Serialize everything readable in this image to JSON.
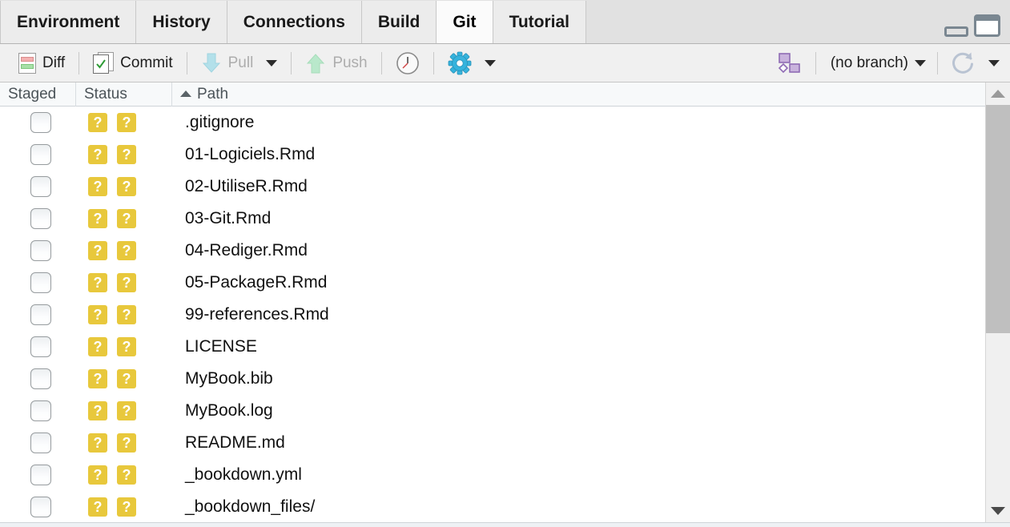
{
  "window": {
    "minimize_label": "Minimize",
    "maximize_label": "Maximize"
  },
  "tabs": [
    {
      "label": "Environment",
      "active": false
    },
    {
      "label": "History",
      "active": false
    },
    {
      "label": "Connections",
      "active": false
    },
    {
      "label": "Build",
      "active": false
    },
    {
      "label": "Git",
      "active": true
    },
    {
      "label": "Tutorial",
      "active": false
    }
  ],
  "toolbar": {
    "diff_label": "Diff",
    "commit_label": "Commit",
    "pull_label": "Pull",
    "push_label": "Push",
    "history_icon": "clock-icon",
    "gear_icon": "gear-icon",
    "new_branch_icon": "new-branch-icon",
    "refresh_icon": "refresh-icon",
    "branch_label": "(no branch)"
  },
  "table": {
    "columns": {
      "staged": "Staged",
      "status": "Status",
      "path": "Path"
    },
    "sort": {
      "column": "Path",
      "direction": "ascending"
    },
    "status_badge_color": "#e8c83c",
    "rows": [
      {
        "staged": false,
        "status_index": "?",
        "status_worktree": "?",
        "path": ".gitignore"
      },
      {
        "staged": false,
        "status_index": "?",
        "status_worktree": "?",
        "path": "01-Logiciels.Rmd"
      },
      {
        "staged": false,
        "status_index": "?",
        "status_worktree": "?",
        "path": "02-UtiliseR.Rmd"
      },
      {
        "staged": false,
        "status_index": "?",
        "status_worktree": "?",
        "path": "03-Git.Rmd"
      },
      {
        "staged": false,
        "status_index": "?",
        "status_worktree": "?",
        "path": "04-Rediger.Rmd"
      },
      {
        "staged": false,
        "status_index": "?",
        "status_worktree": "?",
        "path": "05-PackageR.Rmd"
      },
      {
        "staged": false,
        "status_index": "?",
        "status_worktree": "?",
        "path": "99-references.Rmd"
      },
      {
        "staged": false,
        "status_index": "?",
        "status_worktree": "?",
        "path": "LICENSE"
      },
      {
        "staged": false,
        "status_index": "?",
        "status_worktree": "?",
        "path": "MyBook.bib"
      },
      {
        "staged": false,
        "status_index": "?",
        "status_worktree": "?",
        "path": "MyBook.log"
      },
      {
        "staged": false,
        "status_index": "?",
        "status_worktree": "?",
        "path": "README.md"
      },
      {
        "staged": false,
        "status_index": "?",
        "status_worktree": "?",
        "path": "_bookdown.yml"
      },
      {
        "staged": false,
        "status_index": "?",
        "status_worktree": "?",
        "path": "_bookdown_files/"
      }
    ]
  }
}
